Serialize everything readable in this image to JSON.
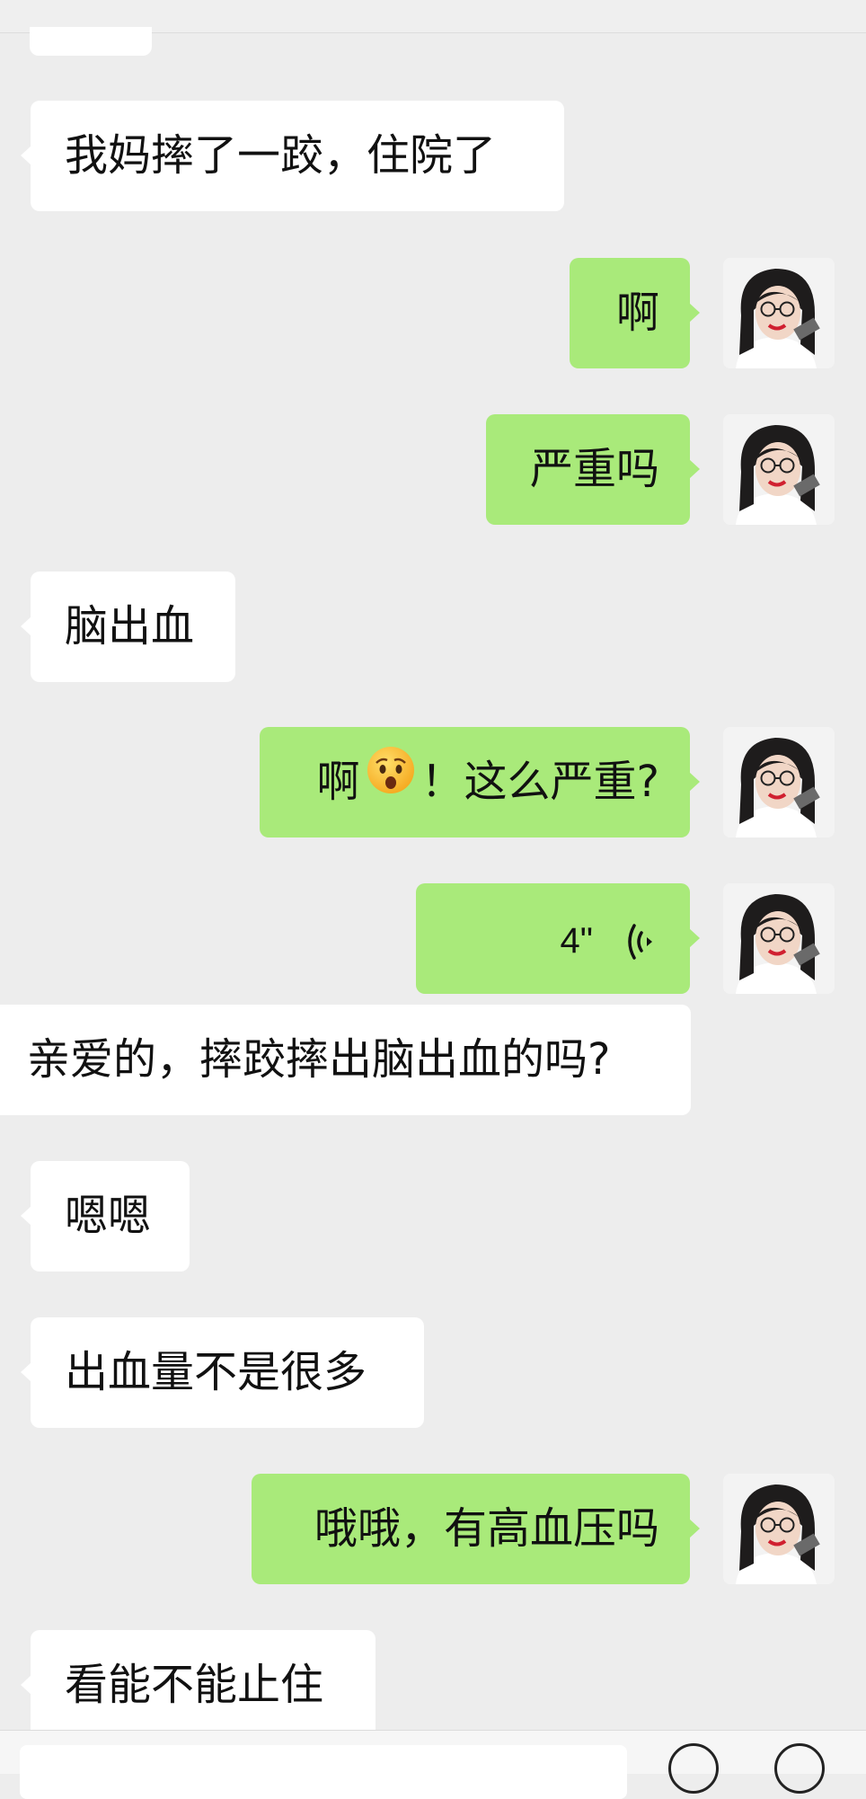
{
  "messages": [
    {
      "side": "recv",
      "text": "我妈摔了一跤，住院了"
    },
    {
      "side": "sent",
      "text": "啊"
    },
    {
      "side": "sent",
      "text": "严重吗"
    },
    {
      "side": "recv",
      "text": "脑出血"
    },
    {
      "side": "sent",
      "text_before": "啊",
      "emoji": "anguished-face-emoji",
      "text_after": "！这么严重?"
    },
    {
      "side": "sent",
      "type": "voice",
      "duration": "4\"",
      "icon": "voice-wave-icon"
    },
    {
      "side": "recv",
      "text": "亲爱的，摔跤摔出脑出血的吗?"
    },
    {
      "side": "recv",
      "text": "嗯嗯"
    },
    {
      "side": "recv",
      "text": "出血量不是很多"
    },
    {
      "side": "sent",
      "text": "哦哦，有高血压吗"
    },
    {
      "side": "recv",
      "text": "看能不能止住"
    }
  ],
  "colors": {
    "background": "#ededed",
    "sent_bubble": "#a9ea7a",
    "received_bubble": "#ffffff"
  }
}
